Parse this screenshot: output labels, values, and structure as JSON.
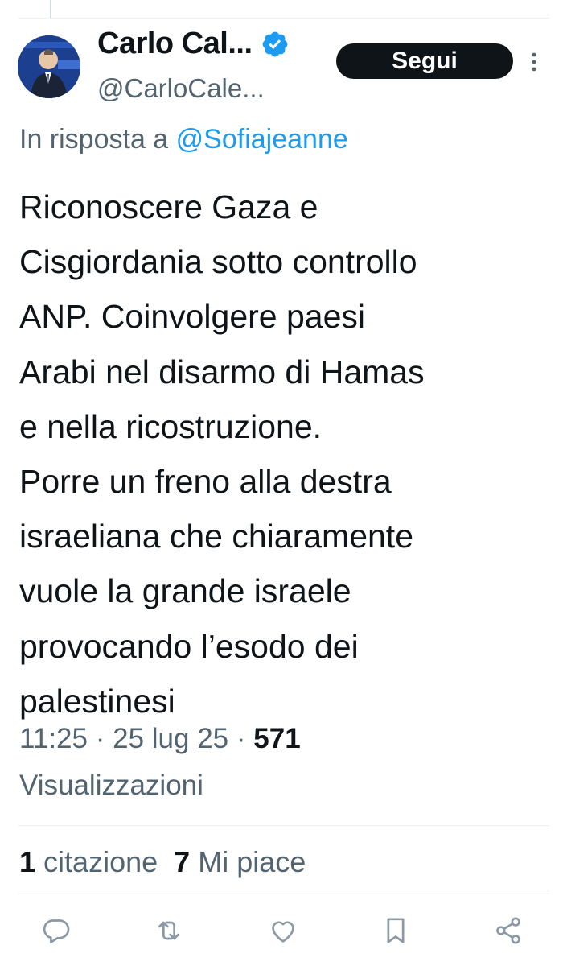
{
  "author": {
    "display_name": "Carlo Cal...",
    "handle": "@CarloCale..."
  },
  "follow_label": "Segui",
  "reply_context": {
    "prefix": "In risposta a",
    "handle": "@Sofiajeanne"
  },
  "tweet_text": "Riconoscere Gaza e\nCisgiordania sotto controllo\nANP. Coinvolgere paesi\nArabi nel disarmo di Hamas\ne nella ricostruzione.\nPorre un freno alla destra\nisraeliana che chiaramente\nvuole la grande israele\nprovocando l’esodo dei\npalestinesi",
  "meta": {
    "time": "11:25",
    "separator": "·",
    "date": "25 lug 25",
    "views_count": "571",
    "views_label": "Visualizzazioni"
  },
  "stats": {
    "quotes_count": "1",
    "quotes_label": "citazione",
    "likes_count": "7",
    "likes_label": "Mi piace"
  },
  "icons": {
    "verified": "verified-badge-icon",
    "more": "more-vertical-icon",
    "reply": "reply-icon",
    "retweet": "retweet-icon",
    "like": "heart-icon",
    "bookmark": "bookmark-icon",
    "share": "share-icon"
  },
  "colors": {
    "accent": "#1d9bf0",
    "text": "#0f1419",
    "secondary": "#536471",
    "button": "#0f1419"
  }
}
